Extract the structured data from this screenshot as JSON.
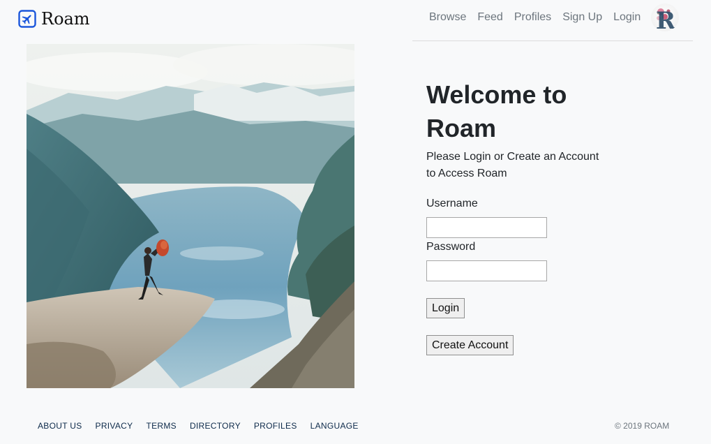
{
  "navbar": {
    "brand": "Roam",
    "links": [
      "Browse",
      "Feed",
      "Profiles",
      "Sign Up",
      "Login"
    ],
    "avatar_letter": "R"
  },
  "main": {
    "title": "Welcome to Roam",
    "subtitle": "Please Login or Create an Account to Access Roam",
    "username_label": "Username",
    "username_value": "",
    "password_label": "Password",
    "password_value": "",
    "login_button": "Login",
    "create_button": "Create Account"
  },
  "footer": {
    "links": [
      "ABOUT US",
      "PRIVACY",
      "TERMS",
      "DIRECTORY",
      "PROFILES",
      "LANGUAGE"
    ],
    "copyright": "© 2019 ROAM"
  },
  "colors": {
    "brand_icon": "#1a56db",
    "background": "#f8f9fa",
    "nav_text": "#6c757d",
    "footer_link": "#0d2a4a"
  },
  "icons": {
    "brand": "airplane-icon"
  }
}
